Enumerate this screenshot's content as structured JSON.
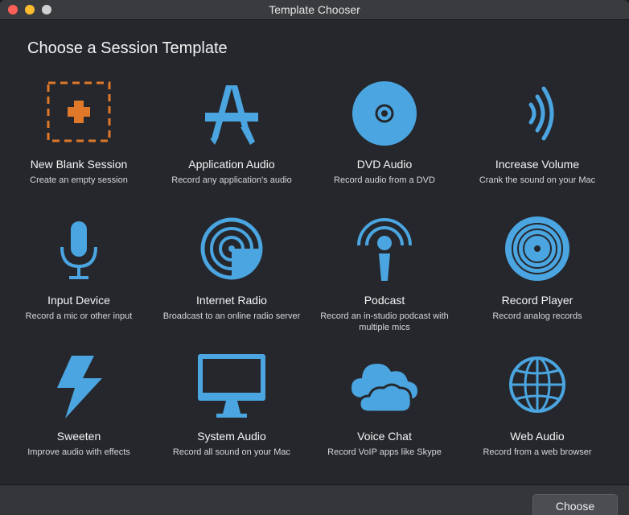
{
  "window": {
    "title": "Template Chooser"
  },
  "heading": "Choose a Session Template",
  "colors": {
    "accent": "#4aa5e0",
    "blank_accent": "#e0782a"
  },
  "templates": [
    {
      "name": "New Blank Session",
      "description": "Create an empty session",
      "icon": "plus-dashed-icon"
    },
    {
      "name": "Application Audio",
      "description": "Record any application's audio",
      "icon": "app-store-icon"
    },
    {
      "name": "DVD Audio",
      "description": "Record audio from a DVD",
      "icon": "dvd-icon"
    },
    {
      "name": "Increase Volume",
      "description": "Crank the sound on your Mac",
      "icon": "sound-waves-icon"
    },
    {
      "name": "Input Device",
      "description": "Record a mic or other input",
      "icon": "microphone-icon"
    },
    {
      "name": "Internet Radio",
      "description": "Broadcast to an online radio server",
      "icon": "radar-icon"
    },
    {
      "name": "Podcast",
      "description": "Record an in-studio podcast with multiple mics",
      "icon": "podcast-icon"
    },
    {
      "name": "Record Player",
      "description": "Record analog records",
      "icon": "vinyl-record-icon"
    },
    {
      "name": "Sweeten",
      "description": "Improve audio with effects",
      "icon": "lightning-icon"
    },
    {
      "name": "System Audio",
      "description": "Record all sound on your Mac",
      "icon": "monitor-icon"
    },
    {
      "name": "Voice Chat",
      "description": "Record VoIP apps like Skype",
      "icon": "cloud-icon"
    },
    {
      "name": "Web Audio",
      "description": "Record from a web browser",
      "icon": "globe-icon"
    }
  ],
  "footer": {
    "choose_label": "Choose"
  }
}
